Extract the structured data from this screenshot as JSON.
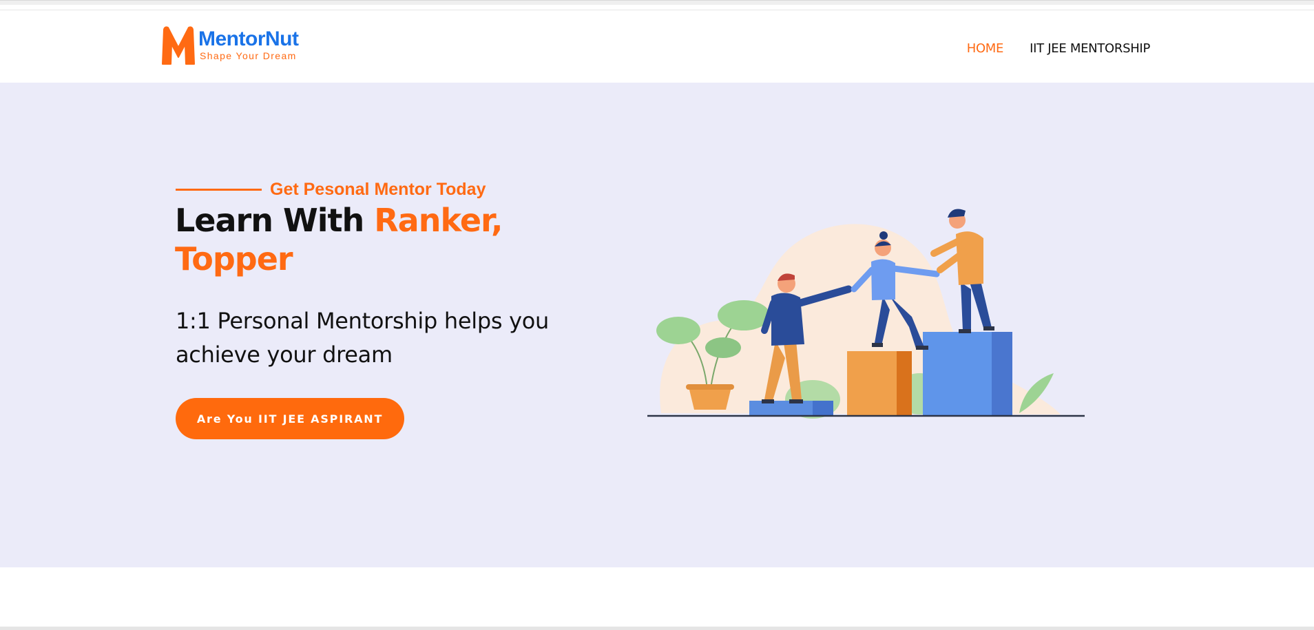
{
  "header": {
    "logo": {
      "name": "MentorNut",
      "tagline": "Shape Your Dream"
    },
    "nav": {
      "home": "HOME",
      "iit_jee_mentorship": "IIT JEE MENTORSHIP"
    }
  },
  "hero": {
    "eyebrow": "Get Pesonal Mentor Today",
    "title_prefix": "Learn With ",
    "title_accent": "Ranker, Topper",
    "subtitle": "1:1 Personal Mentorship helps you achieve your dream",
    "cta_label": "Are You IIT JEE ASPIRANT"
  },
  "colors": {
    "brand_orange": "#ff6a13",
    "brand_blue": "#1a73e8",
    "hero_background": "#ebebf9",
    "text_dark": "#111111"
  },
  "icons": {
    "logo_mark": "orange-m-logo-icon",
    "illustration": "people-helping-climb-blocks-illustration"
  }
}
